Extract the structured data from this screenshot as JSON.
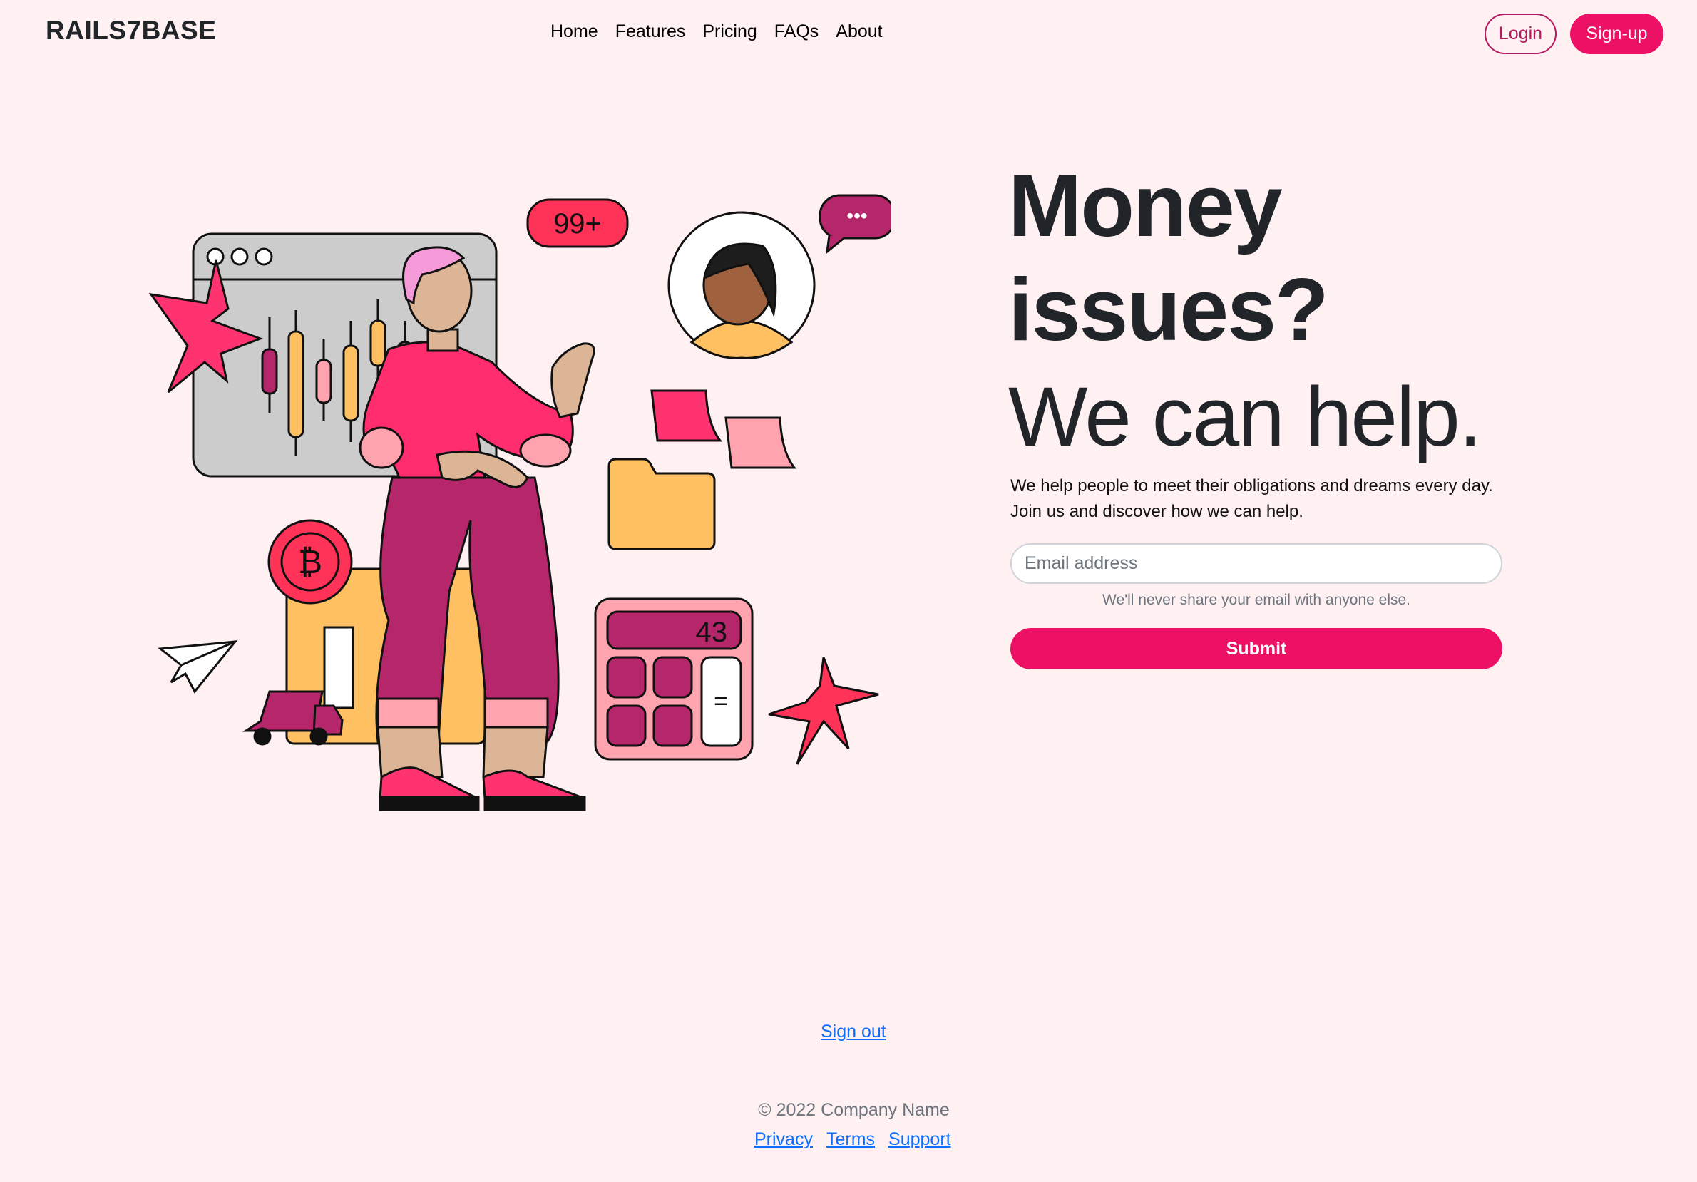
{
  "brand": "RAILS7BASE",
  "nav": {
    "items": [
      {
        "label": "Home"
      },
      {
        "label": "Features"
      },
      {
        "label": "Pricing"
      },
      {
        "label": "FAQs"
      },
      {
        "label": "About"
      }
    ]
  },
  "auth": {
    "login_label": "Login",
    "signup_label": "Sign-up"
  },
  "hero": {
    "title": "Money issues?",
    "subtitle": "We can help.",
    "description": "We help people to meet their obligations and dreams every day. Join us and discover how we can help.",
    "email_placeholder": "Email address",
    "email_value": "",
    "email_help": "We'll never share your email with anyone else.",
    "submit_label": "Submit"
  },
  "illustration": {
    "notification_badge": "99+",
    "calculator_display": "43",
    "calculator_equals": "=",
    "coin_symbol": "₿",
    "chat_bubble": "•••"
  },
  "footer": {
    "signout_label": "Sign out",
    "copyright": "© 2022 Company Name",
    "links": [
      {
        "label": "Privacy"
      },
      {
        "label": "Terms"
      },
      {
        "label": "Support"
      }
    ]
  },
  "colors": {
    "background": "#fff0f1",
    "accent": "#ed1165",
    "accent_dark": "#b5195f",
    "link": "#0d6efd"
  }
}
